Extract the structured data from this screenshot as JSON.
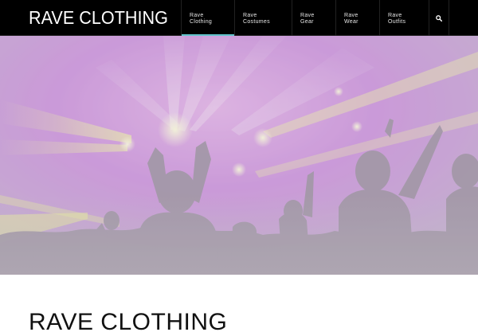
{
  "site": {
    "title": "RAVE CLOTHING"
  },
  "nav": {
    "items": [
      {
        "line1": "Rave",
        "line2": "Clothing",
        "active": true
      },
      {
        "line1": "Rave",
        "line2": "Costumes",
        "active": false
      },
      {
        "line1": "Rave",
        "line2": "Gear",
        "active": false
      },
      {
        "line1": "Rave",
        "line2": "Wear",
        "active": false
      },
      {
        "line1": "Rave",
        "line2": "Outfits",
        "active": false
      }
    ],
    "search_icon": "search-icon"
  },
  "hero": {
    "image": "concert-crowd-purple-lights-photo"
  },
  "content": {
    "heading": "RAVE CLOTHING"
  },
  "colors": {
    "header_bg": "#000000",
    "active_underline": "#5fc3c9",
    "light_purple": "#e08cf0",
    "light_yellow": "#eaf08a",
    "hero_overlay": "#bdbdbd"
  }
}
